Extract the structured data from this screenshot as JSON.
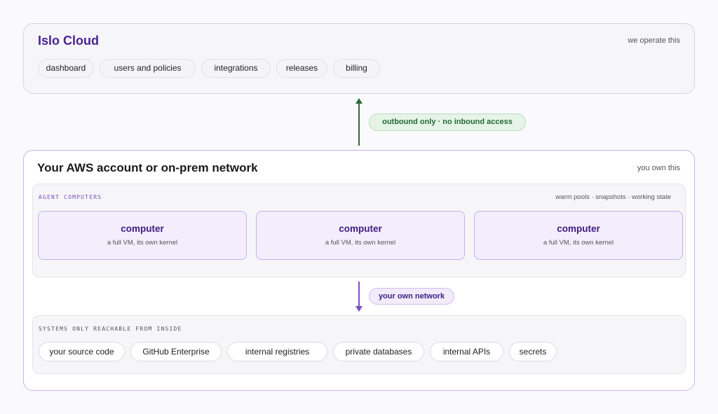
{
  "cloud": {
    "title": "Islo Cloud",
    "note": "we operate this",
    "pills": [
      "dashboard",
      "users and policies",
      "integrations",
      "releases",
      "billing"
    ]
  },
  "link_up": {
    "label": "outbound only · no inbound access",
    "color": "#2f6a3b"
  },
  "aws": {
    "title": "Your AWS account or on-prem network",
    "note": "you own this",
    "agent_section": {
      "label": "AGENT COMPUTERS",
      "note": "warm pools · snapshots · working state",
      "computers": [
        {
          "title": "computer",
          "subtitle": "a full VM, its own kernel"
        },
        {
          "title": "computer",
          "subtitle": "a full VM, its own kernel"
        },
        {
          "title": "computer",
          "subtitle": "a full VM, its own kernel"
        }
      ]
    },
    "link_down": {
      "label": "your own network",
      "color": "#7b4fc2"
    },
    "systems_section": {
      "label": "SYSTEMS ONLY REACHABLE FROM INSIDE",
      "pills": [
        "your source code",
        "GitHub Enterprise",
        "internal registries",
        "private databases",
        "internal APIs",
        "secrets"
      ]
    }
  },
  "colors": {
    "accent_purple": "#4a2391",
    "green_badge_bg": "#e6f4e8",
    "purple_card_bg": "#f3edfc"
  }
}
